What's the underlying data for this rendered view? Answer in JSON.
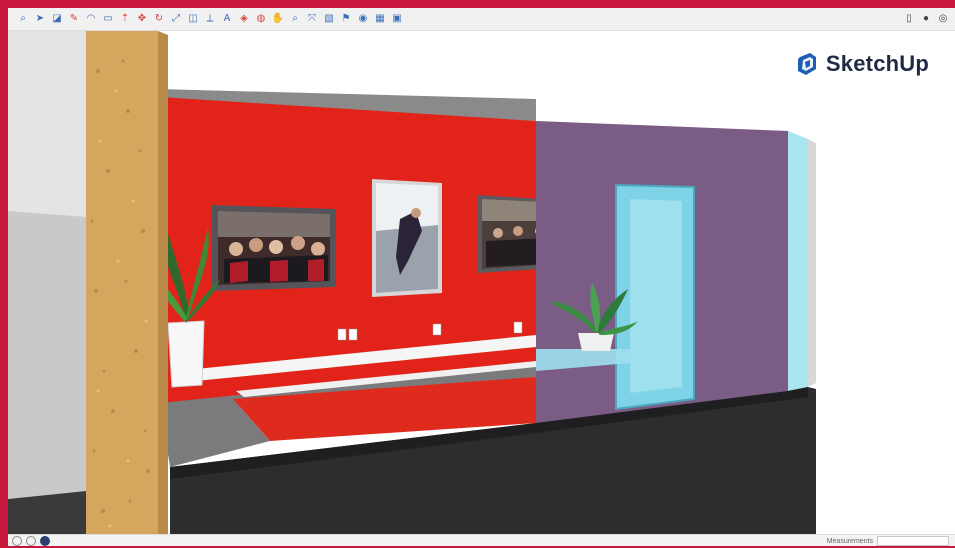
{
  "toolbar": {
    "left_tools": [
      {
        "icon": "search-icon",
        "glyph": "⌕"
      },
      {
        "icon": "select-arrow-icon",
        "glyph": "➤"
      },
      {
        "icon": "eraser-icon",
        "glyph": "◪"
      },
      {
        "icon": "pencil-icon",
        "glyph": "✎"
      },
      {
        "icon": "arc-icon",
        "glyph": "◠"
      },
      {
        "icon": "rectangle-icon",
        "glyph": "▭"
      },
      {
        "icon": "push-pull-icon",
        "glyph": "⇡"
      },
      {
        "icon": "move-icon",
        "glyph": "✥"
      },
      {
        "icon": "rotate-icon",
        "glyph": "↻"
      },
      {
        "icon": "scale-icon",
        "glyph": "⤢"
      },
      {
        "icon": "offset-icon",
        "glyph": "◫"
      },
      {
        "icon": "tape-measure-icon",
        "glyph": "⟂"
      },
      {
        "icon": "text-icon",
        "glyph": "A"
      },
      {
        "icon": "paint-bucket-icon",
        "glyph": "◈"
      },
      {
        "icon": "orbit-icon",
        "glyph": "◍"
      },
      {
        "icon": "pan-icon",
        "glyph": "✋"
      },
      {
        "icon": "zoom-icon",
        "glyph": "⌕"
      },
      {
        "icon": "zoom-extents-icon",
        "glyph": "⤧"
      },
      {
        "icon": "section-plane-icon",
        "glyph": "▧"
      },
      {
        "icon": "walk-icon",
        "glyph": "⚑"
      },
      {
        "icon": "look-around-icon",
        "glyph": "◉"
      },
      {
        "icon": "warehouse-icon",
        "glyph": "▦"
      },
      {
        "icon": "extension-icon",
        "glyph": "▣"
      }
    ],
    "right_tools": [
      {
        "icon": "document-icon",
        "glyph": "▯"
      },
      {
        "icon": "account-icon",
        "glyph": "●"
      },
      {
        "icon": "help-icon",
        "glyph": "◎"
      }
    ]
  },
  "logo": {
    "text": "SketchUp",
    "icon": "sketchup-logo-icon",
    "color": "#1f2a44"
  },
  "statusbar": {
    "measurements_label": "Measurements",
    "measurements_value": ""
  },
  "colors": {
    "brand_red": "#c8193c",
    "wall_red": "#e2231a",
    "glass_blue": "#7fd3e6",
    "carpet_dark": "#2d2d2f",
    "cork": "#d6a55e"
  }
}
